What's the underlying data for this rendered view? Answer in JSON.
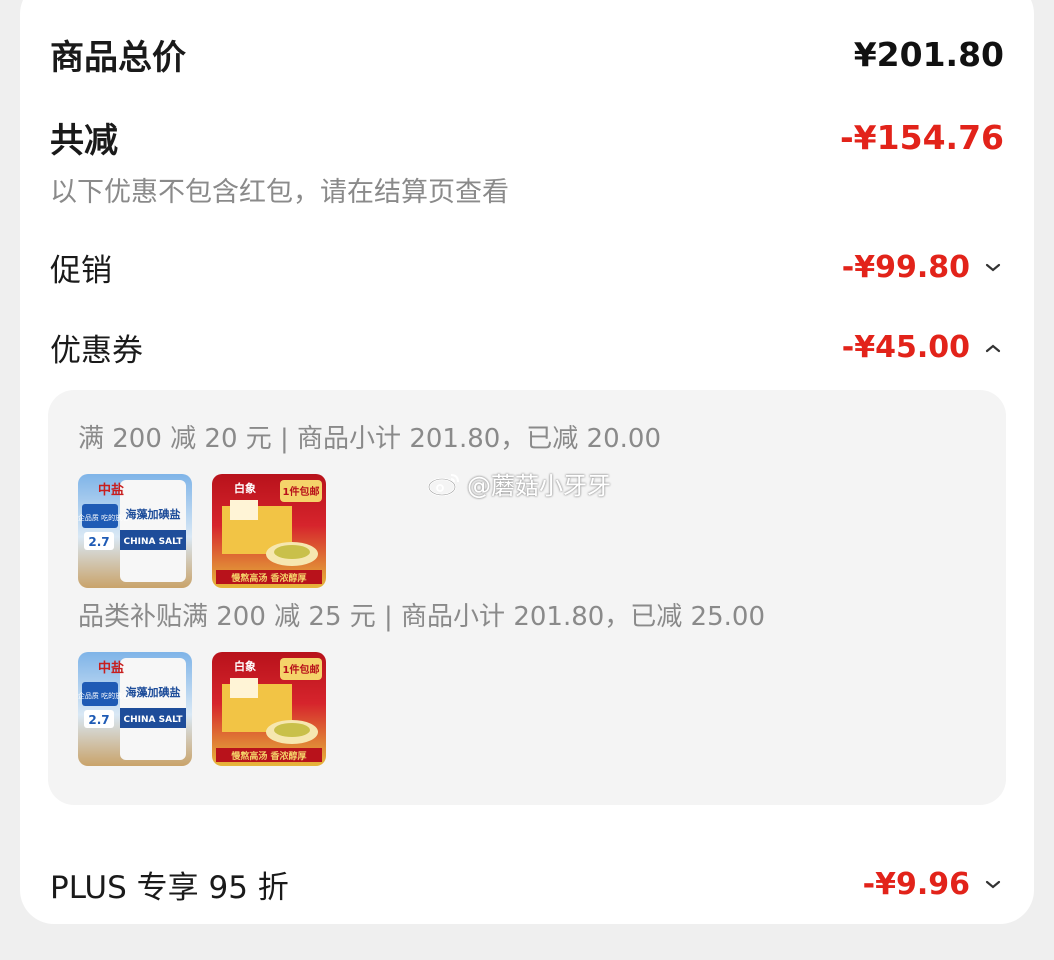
{
  "summary": {
    "total_label": "商品总价",
    "total_value": "¥201.80",
    "reduce_label": "共减",
    "reduce_value": "-¥154.76",
    "note": "以下优惠不包含红包，请在结算页查看"
  },
  "promotion": {
    "label": "促销",
    "value": "-¥99.80",
    "chevron": "chevron-down-icon"
  },
  "coupon": {
    "label": "优惠券",
    "value": "-¥45.00",
    "chevron": "chevron-up-icon",
    "groups": [
      {
        "title": "满 200 减 20 元 | 商品小计 201.80，已减 20.00",
        "products": [
          "salt-product",
          "noodle-product"
        ]
      },
      {
        "title": "品类补贴满 200 减 25 元 | 商品小计 201.80，已减 25.00",
        "products": [
          "salt-product",
          "noodle-product"
        ]
      }
    ]
  },
  "plus": {
    "label": "PLUS 专享 95 折",
    "value": "-¥9.96",
    "chevron": "chevron-down-icon"
  },
  "product_text": {
    "salt_brand": "中盐",
    "salt_badge": "央企品质 吃的放心",
    "salt_price": "2.7",
    "salt_name": "海藻加碘盐",
    "salt_en": "CHINA SALT",
    "noodle_brand": "白象",
    "noodle_badge": "1件包邮",
    "noodle_slogan": "慢熬高汤 香浓醇厚"
  },
  "watermark": {
    "text": "@蘑菇小牙牙",
    "icon": "weibo-icon"
  },
  "colors": {
    "accent_red": "#e2231a",
    "muted_text": "#8a8a8a",
    "panel_bg": "#f4f4f4"
  }
}
